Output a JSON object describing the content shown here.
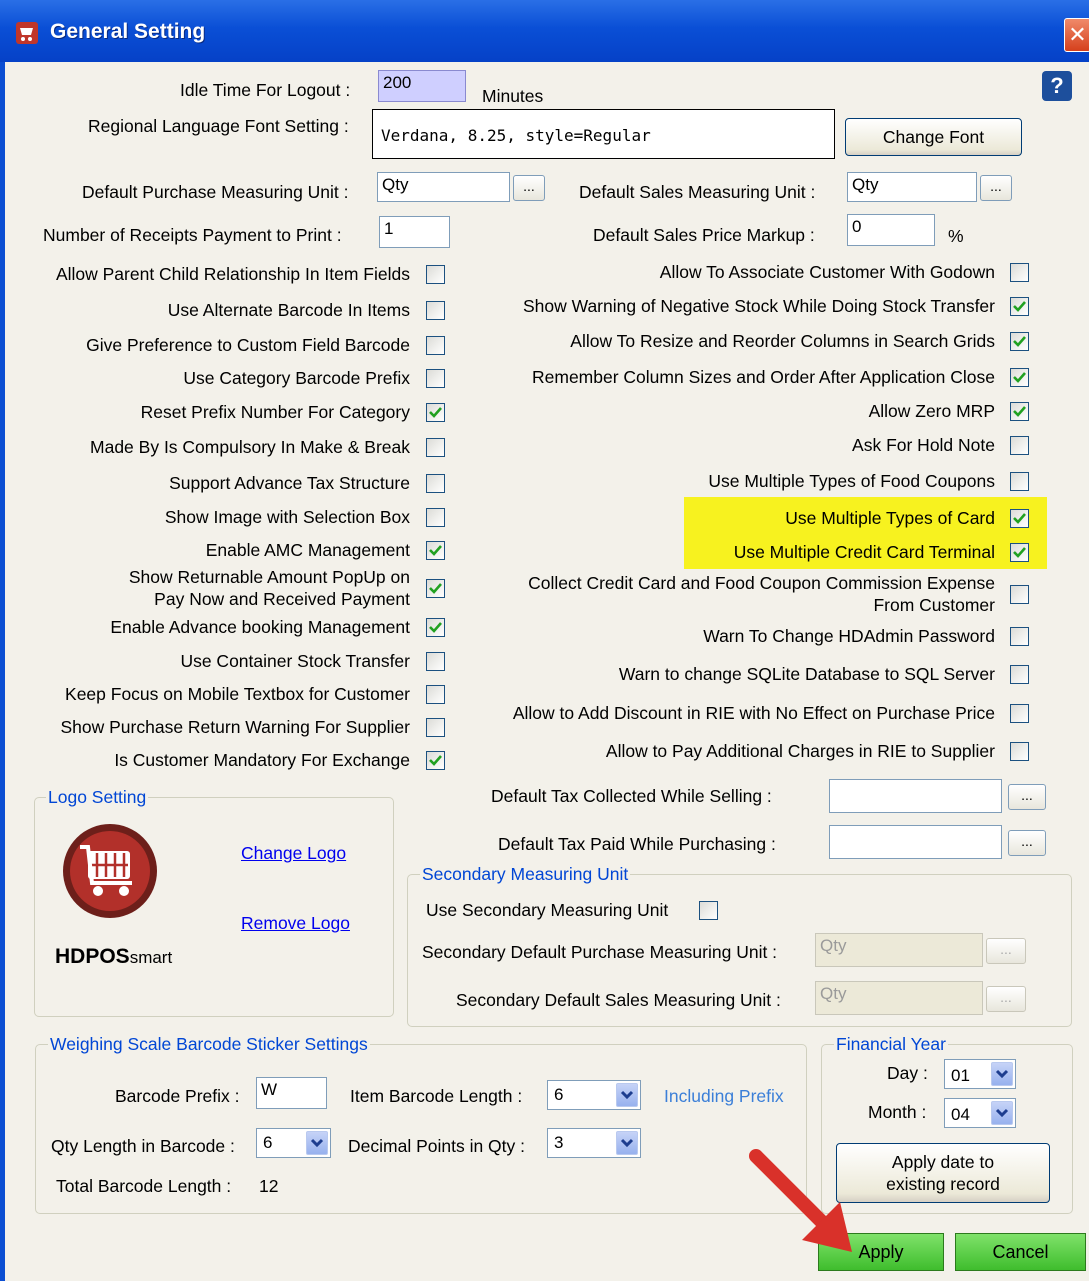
{
  "window": {
    "title": "General Setting",
    "close_glyph": "✕",
    "help_glyph": "?"
  },
  "top": {
    "idle_label": "Idle Time For Logout :",
    "idle_value": "200",
    "idle_unit": "Minutes",
    "font_label": "Regional Language Font Setting :",
    "font_value": "Verdana, 8.25, style=Regular",
    "change_font": "Change Font",
    "purchase_unit_label": "Default Purchase Measuring Unit :",
    "purchase_unit_value": "Qty",
    "sales_unit_label": "Default Sales Measuring Unit :",
    "sales_unit_value": "Qty",
    "receipts_label": "Number of Receipts Payment to Print :",
    "receipts_value": "1",
    "markup_label": "Default Sales Price Markup :",
    "markup_value": "0",
    "markup_unit": "%",
    "ellipsis": "..."
  },
  "left_options": [
    {
      "label": "Allow Parent Child Relationship In Item Fields",
      "checked": false
    },
    {
      "label": "Use Alternate Barcode In Items",
      "checked": false
    },
    {
      "label": "Give Preference to Custom Field Barcode",
      "checked": false
    },
    {
      "label": "Use Category Barcode Prefix",
      "checked": false
    },
    {
      "label": "Reset Prefix Number For Category",
      "checked": true
    },
    {
      "label": "Made By Is Compulsory In Make & Break",
      "checked": false
    },
    {
      "label": "Support Advance Tax Structure",
      "checked": false
    },
    {
      "label": "Show Image with Selection Box",
      "checked": false
    },
    {
      "label": "Enable AMC Management",
      "checked": true
    },
    {
      "label": "Show Returnable Amount PopUp on\nPay Now and Received Payment",
      "checked": true
    },
    {
      "label": "Enable Advance booking Management",
      "checked": true
    },
    {
      "label": "Use Container Stock Transfer",
      "checked": false
    },
    {
      "label": "Keep Focus on Mobile Textbox for Customer",
      "checked": false
    },
    {
      "label": "Show Purchase Return Warning For Supplier",
      "checked": false
    },
    {
      "label": "Is Customer Mandatory For Exchange",
      "checked": true
    }
  ],
  "right_options": [
    {
      "label": "Allow To Associate Customer With Godown",
      "checked": false
    },
    {
      "label": "Show Warning of Negative Stock While Doing Stock Transfer",
      "checked": true
    },
    {
      "label": "Allow To Resize and Reorder Columns in Search Grids",
      "checked": true
    },
    {
      "label": "Remember Column Sizes and Order After Application Close",
      "checked": true
    },
    {
      "label": "Allow Zero MRP",
      "checked": true
    },
    {
      "label": "Ask For Hold Note",
      "checked": false
    },
    {
      "label": "Use Multiple Types of Food Coupons",
      "checked": false
    },
    {
      "label": "Use Multiple Types of Card",
      "checked": true
    },
    {
      "label": "Use Multiple Credit Card Terminal",
      "checked": true
    },
    {
      "label": "Collect Credit Card and Food Coupon Commission Expense\nFrom Customer",
      "checked": false
    },
    {
      "label": "Warn To Change HDAdmin Password",
      "checked": false
    },
    {
      "label": "Warn to change SQLite Database to SQL Server",
      "checked": false
    },
    {
      "label": "Allow to Add Discount in RIE with No Effect on Purchase Price",
      "checked": false
    },
    {
      "label": "Allow to Pay Additional Charges in RIE to Supplier",
      "checked": false
    }
  ],
  "highlight_color": "#f7f21f",
  "tax": {
    "collected_label": "Default Tax Collected  While Selling :",
    "paid_label": "Default Tax Paid While Purchasing :"
  },
  "logo": {
    "group_title": "Logo Setting",
    "change_logo": "Change Logo",
    "remove_logo": "Remove Logo",
    "brand_text": "HDPOS",
    "brand_suffix": "smart"
  },
  "secondary": {
    "group_title": "Secondary Measuring Unit",
    "use_label": "Use Secondary Measuring Unit",
    "purchase_label": "Secondary Default Purchase Measuring Unit :",
    "purchase_value": "Qty",
    "sales_label": "Secondary Default Sales Measuring Unit :",
    "sales_value": "Qty"
  },
  "weighing": {
    "group_title": "Weighing Scale Barcode Sticker Settings",
    "prefix_label": "Barcode Prefix :",
    "prefix_value": "W",
    "item_len_label": "Item Barcode Length :",
    "item_len_value": "6",
    "including_prefix": "Including Prefix",
    "qty_len_label": "Qty Length in Barcode :",
    "qty_len_value": "6",
    "decimal_label": "Decimal Points in Qty :",
    "decimal_value": "3",
    "total_label": "Total Barcode Length :",
    "total_value": "12"
  },
  "financial": {
    "group_title": "Financial Year",
    "day_label": "Day :",
    "day_value": "01",
    "month_label": "Month :",
    "month_value": "04",
    "apply_date": "Apply date to\nexisting record"
  },
  "footer": {
    "apply": "Apply",
    "cancel": "Cancel"
  }
}
